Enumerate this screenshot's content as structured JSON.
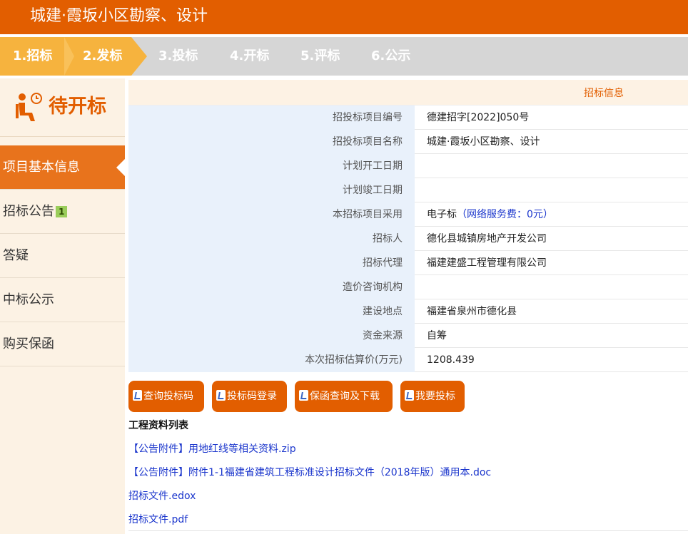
{
  "header": {
    "title": "城建·霞坂小区勘察、设计"
  },
  "steps": [
    {
      "label": "1.招标",
      "state": "done"
    },
    {
      "label": "2.发标",
      "state": "current"
    },
    {
      "label": "3.投标",
      "state": "todo"
    },
    {
      "label": "4.开标",
      "state": "todo"
    },
    {
      "label": "5.评标",
      "state": "todo"
    },
    {
      "label": "6.公示",
      "state": "todo"
    }
  ],
  "sidebar": {
    "status": "待开标",
    "status_icon": "waiting-person-clock-icon",
    "items": [
      {
        "label": "项目基本信息",
        "active": true
      },
      {
        "label": "招标公告",
        "badge": "1"
      },
      {
        "label": "答疑"
      },
      {
        "label": "中标公示"
      },
      {
        "label": "购买保函"
      }
    ]
  },
  "info": {
    "heading": "招标信息",
    "rows": [
      {
        "key": "招投标项目编号",
        "value": "德建招字[2022]050号"
      },
      {
        "key": "招投标项目名称",
        "value": "城建·霞坂小区勘察、设计"
      },
      {
        "key": "计划开工日期",
        "value": ""
      },
      {
        "key": "计划竣工日期",
        "value": ""
      },
      {
        "key": "本招标项目采用",
        "value": "电子标",
        "extra": "（网络服务费：0元）"
      },
      {
        "key": "招标人",
        "value": "德化县城镇房地产开发公司"
      },
      {
        "key": "招标代理",
        "value": "福建建盛工程管理有限公司"
      },
      {
        "key": "造价咨询机构",
        "value": ""
      },
      {
        "key": "建设地点",
        "value": "福建省泉州市德化县"
      },
      {
        "key": "资金来源",
        "value": "自筹"
      },
      {
        "key": "本次招标估算价(万元)",
        "value": "1208.439"
      }
    ]
  },
  "buttons": [
    "查询投标码",
    "投标码登录",
    "保函查询及下载",
    "我要投标"
  ],
  "files": {
    "title": "工程资料列表",
    "items": [
      "【公告附件】用地红线等相关资料.zip",
      "【公告附件】附件1-1福建省建筑工程标准设计招标文件（2018年版）通用本.doc",
      "招标文件.edox",
      "招标文件.pdf"
    ]
  },
  "colors": {
    "brand": "#e25e00",
    "step_done": "#f6b33e",
    "step_todo": "#d6d6d6",
    "link": "#1a35cc",
    "label_bg": "#e9f1fb"
  }
}
